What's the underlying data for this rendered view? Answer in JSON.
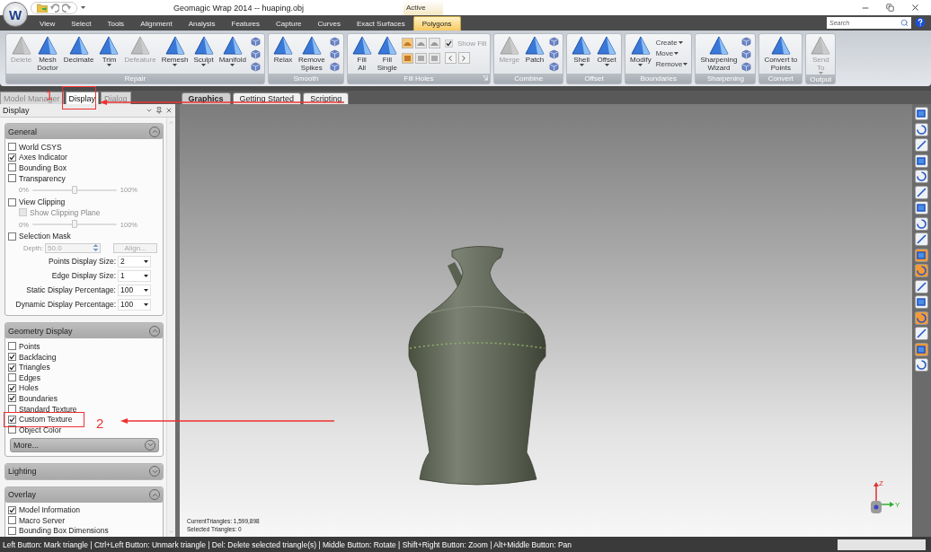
{
  "title_bar": {
    "app_button": "W",
    "title": "Geomagic Wrap 2014 -- huaping.obj",
    "context_label": "Active"
  },
  "menu_tabs": [
    {
      "label": "View",
      "selected": false
    },
    {
      "label": "Select",
      "selected": false
    },
    {
      "label": "Tools",
      "selected": false
    },
    {
      "label": "Alignment",
      "selected": false
    },
    {
      "label": "Analysis",
      "selected": false
    },
    {
      "label": "Features",
      "selected": false
    },
    {
      "label": "Capture",
      "selected": false
    },
    {
      "label": "Curves",
      "selected": false
    },
    {
      "label": "Exact Surfaces",
      "selected": false
    },
    {
      "label": "Polygons",
      "selected": true
    }
  ],
  "search": {
    "placeholder": "Search"
  },
  "ribbon_groups": [
    {
      "label": "Repair",
      "launcher": false,
      "items": [
        {
          "kind": "large",
          "label_lines": [
            "Delete"
          ],
          "disabled": true,
          "dropdown": false
        },
        {
          "kind": "large",
          "label_lines": [
            "Mesh",
            "Doctor"
          ],
          "disabled": false,
          "dropdown": false
        },
        {
          "kind": "large",
          "label_lines": [
            "Decimate"
          ],
          "disabled": false,
          "dropdown": false
        },
        {
          "kind": "large",
          "label_lines": [
            "Trim"
          ],
          "disabled": false,
          "dropdown": true
        },
        {
          "kind": "large",
          "label_lines": [
            "Defeature"
          ],
          "disabled": true,
          "dropdown": false
        },
        {
          "kind": "large",
          "label_lines": [
            "Remesh"
          ],
          "disabled": false,
          "dropdown": true
        },
        {
          "kind": "large",
          "label_lines": [
            "Sculpt"
          ],
          "disabled": false,
          "dropdown": true
        },
        {
          "kind": "large",
          "label_lines": [
            "Manifold"
          ],
          "disabled": false,
          "dropdown": true
        },
        {
          "kind": "icon-stack"
        }
      ]
    },
    {
      "label": "Smooth",
      "launcher": false,
      "items": [
        {
          "kind": "large",
          "label_lines": [
            "Relax"
          ],
          "disabled": false,
          "dropdown": false
        },
        {
          "kind": "large",
          "label_lines": [
            "Remove",
            "Spikes"
          ],
          "disabled": false,
          "dropdown": false
        },
        {
          "kind": "icon-stack"
        }
      ]
    },
    {
      "label": "Fill Holes",
      "launcher": true,
      "items": [
        {
          "kind": "large",
          "label_lines": [
            "Fill",
            "All"
          ],
          "disabled": false,
          "dropdown": false
        },
        {
          "kind": "large",
          "label_lines": [
            "Fill",
            "Single"
          ],
          "disabled": false,
          "dropdown": false
        },
        {
          "kind": "fill-options",
          "checkbox": {
            "label": "Show Fill",
            "checked": true
          }
        }
      ]
    },
    {
      "label": "Combine",
      "launcher": false,
      "items": [
        {
          "kind": "large",
          "label_lines": [
            "Merge"
          ],
          "disabled": true,
          "dropdown": false
        },
        {
          "kind": "large",
          "label_lines": [
            "Patch"
          ],
          "disabled": false,
          "dropdown": false
        },
        {
          "kind": "icon-stack"
        }
      ]
    },
    {
      "label": "Offset",
      "launcher": false,
      "items": [
        {
          "kind": "large",
          "label_lines": [
            "Shell"
          ],
          "disabled": false,
          "dropdown": true
        },
        {
          "kind": "large",
          "label_lines": [
            "Offset"
          ],
          "disabled": false,
          "dropdown": true
        }
      ]
    },
    {
      "label": "Boundaries",
      "launcher": false,
      "items": [
        {
          "kind": "large",
          "label_lines": [
            "Modify"
          ],
          "disabled": false,
          "dropdown": true
        },
        {
          "kind": "text-stack",
          "entries": [
            "Create",
            "Move",
            "Remove"
          ]
        }
      ]
    },
    {
      "label": "Sharpening",
      "launcher": false,
      "items": [
        {
          "kind": "large",
          "label_lines": [
            "Sharpening",
            "Wizard"
          ],
          "disabled": false,
          "dropdown": false
        },
        {
          "kind": "icon-stack"
        }
      ]
    },
    {
      "label": "Convert",
      "launcher": false,
      "items": [
        {
          "kind": "large",
          "label_lines": [
            "Convert to",
            "Points"
          ],
          "disabled": false,
          "dropdown": false
        }
      ]
    },
    {
      "label": "Output",
      "launcher": false,
      "items": [
        {
          "kind": "large",
          "label_lines": [
            "Send",
            "To"
          ],
          "disabled": true,
          "dropdown": true
        }
      ]
    }
  ],
  "panel_tabs": [
    {
      "label": "Model Manager",
      "selected": false
    },
    {
      "label": "Display",
      "selected": true
    },
    {
      "label": "Dialog",
      "selected": false
    }
  ],
  "document_tabs": [
    {
      "label": "Graphics",
      "selected": true
    },
    {
      "label": "Getting Started",
      "selected": false
    },
    {
      "label": "Scripting",
      "selected": false
    }
  ],
  "display_panel": {
    "title": "Display",
    "sections": [
      {
        "title": "General",
        "expanded": true,
        "items": [
          {
            "kind": "checkbox",
            "label": "World CSYS",
            "checked": false
          },
          {
            "kind": "checkbox",
            "label": "Axes Indicator",
            "checked": true
          },
          {
            "kind": "checkbox",
            "label": "Bounding Box",
            "checked": false
          },
          {
            "kind": "checkbox",
            "label": "Transparency",
            "checked": false
          },
          {
            "kind": "slider",
            "min_label": "0%",
            "max_label": "100%",
            "level": 0.5
          },
          {
            "kind": "checkbox",
            "label": "View Clipping",
            "checked": false,
            "children": [
              {
                "kind": "checkbox",
                "label": "Show Clipping Plane",
                "checked": false,
                "disabled": true
              }
            ]
          },
          {
            "kind": "slider",
            "min_label": "0%",
            "max_label": "100%",
            "level": 0.5
          },
          {
            "kind": "checkbox",
            "label": "Selection Mask",
            "checked": false
          },
          {
            "kind": "spin",
            "label": "Depth:",
            "value": "50.0",
            "button": "Align...",
            "disabled": true
          },
          {
            "kind": "select",
            "label": "Points Display Size:",
            "value": "2"
          },
          {
            "kind": "select",
            "label": "Edge Display Size:",
            "value": "1"
          },
          {
            "kind": "select",
            "label": "Static Display Percentage:",
            "value": "100"
          },
          {
            "kind": "select",
            "label": "Dynamic Display Percentage:",
            "value": "100"
          }
        ]
      },
      {
        "title": "Geometry Display",
        "expanded": true,
        "more_button": "More...",
        "items": [
          {
            "kind": "checkbox",
            "label": "Points",
            "checked": false
          },
          {
            "kind": "checkbox",
            "label": "Backfacing",
            "checked": true
          },
          {
            "kind": "checkbox",
            "label": "Triangles",
            "checked": true
          },
          {
            "kind": "checkbox",
            "label": "Edges",
            "checked": false
          },
          {
            "kind": "checkbox",
            "label": "Holes",
            "checked": true
          },
          {
            "kind": "checkbox",
            "label": "Boundaries",
            "checked": true
          },
          {
            "kind": "checkbox",
            "label": "Standard Texture",
            "checked": false
          },
          {
            "kind": "checkbox",
            "label": "Custom Texture",
            "checked": true
          },
          {
            "kind": "checkbox",
            "label": "Object Color",
            "checked": false
          }
        ]
      },
      {
        "title": "Lighting",
        "expanded": false
      },
      {
        "title": "Overlay",
        "expanded": true,
        "items": [
          {
            "kind": "checkbox",
            "label": "Model Information",
            "checked": true
          },
          {
            "kind": "checkbox",
            "label": "Macro Server",
            "checked": false
          },
          {
            "kind": "checkbox",
            "label": "Bounding Box Dimensions",
            "checked": false
          }
        ]
      }
    ]
  },
  "viewport": {
    "stats": [
      "CurrentTriangles: 1,599,898",
      "Selected Triangles: 0"
    ],
    "axis_labels": [
      "Z",
      "Y"
    ]
  },
  "status_bar": {
    "hint": "Left Button: Mark triangle | Ctrl+Left Button: Unmark triangle | Del: Delete selected triangle(s) | Middle Button: Rotate | Shift+Right Button: Zoom | Alt+Middle Button: Pan"
  },
  "annotations": [
    {
      "label": "1"
    },
    {
      "label": "2"
    }
  ]
}
